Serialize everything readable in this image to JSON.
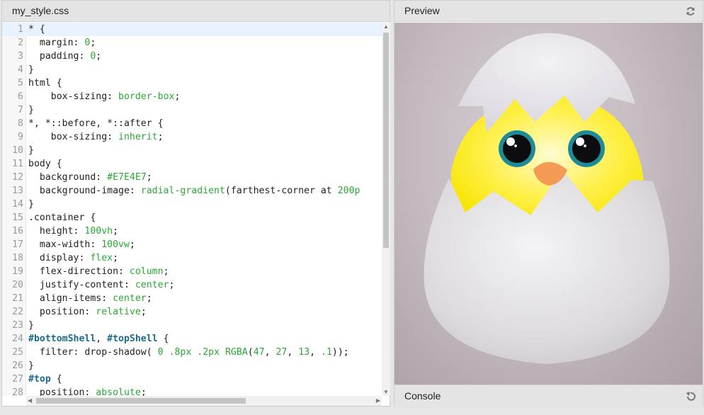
{
  "editor": {
    "filename": "my_style.css",
    "lines": [
      {
        "n": "1",
        "parts": [
          [
            "sel",
            "* {"
          ]
        ]
      },
      {
        "n": "2",
        "parts": [
          [
            "prop",
            "  margin: "
          ],
          [
            "num",
            "0"
          ],
          [
            "prop",
            ";"
          ]
        ]
      },
      {
        "n": "3",
        "parts": [
          [
            "prop",
            "  padding: "
          ],
          [
            "num",
            "0"
          ],
          [
            "prop",
            ";"
          ]
        ]
      },
      {
        "n": "4",
        "parts": [
          [
            "sel",
            "}"
          ]
        ]
      },
      {
        "n": "5",
        "parts": [
          [
            "sel",
            "html {"
          ]
        ]
      },
      {
        "n": "6",
        "parts": [
          [
            "prop",
            "    box-sizing: "
          ],
          [
            "val",
            "border-box"
          ],
          [
            "prop",
            ";"
          ]
        ]
      },
      {
        "n": "7",
        "parts": [
          [
            "sel",
            "}"
          ]
        ]
      },
      {
        "n": "8",
        "parts": [
          [
            "sel",
            "*, *::before, *::after {"
          ]
        ]
      },
      {
        "n": "9",
        "parts": [
          [
            "prop",
            "    box-sizing: "
          ],
          [
            "val",
            "inherit"
          ],
          [
            "prop",
            ";"
          ]
        ]
      },
      {
        "n": "10",
        "parts": [
          [
            "sel",
            "}"
          ]
        ]
      },
      {
        "n": "11",
        "parts": [
          [
            "sel",
            "body {"
          ]
        ]
      },
      {
        "n": "12",
        "parts": [
          [
            "prop",
            "  background: "
          ],
          [
            "val",
            "#E7E4E7"
          ],
          [
            "prop",
            ";"
          ]
        ]
      },
      {
        "n": "13",
        "parts": [
          [
            "prop",
            "  background-image: "
          ],
          [
            "val",
            "radial-gradient"
          ],
          [
            "prop",
            "(farthest-corner at "
          ],
          [
            "num",
            "200p"
          ]
        ]
      },
      {
        "n": "14",
        "parts": [
          [
            "sel",
            "}"
          ]
        ]
      },
      {
        "n": "15",
        "parts": [
          [
            "sel",
            ".container {"
          ]
        ]
      },
      {
        "n": "16",
        "parts": [
          [
            "prop",
            "  height: "
          ],
          [
            "val",
            "100vh"
          ],
          [
            "prop",
            ";"
          ]
        ]
      },
      {
        "n": "17",
        "parts": [
          [
            "prop",
            "  max-width: "
          ],
          [
            "val",
            "100vw"
          ],
          [
            "prop",
            ";"
          ]
        ]
      },
      {
        "n": "18",
        "parts": [
          [
            "prop",
            "  display: "
          ],
          [
            "val",
            "flex"
          ],
          [
            "prop",
            ";"
          ]
        ]
      },
      {
        "n": "19",
        "parts": [
          [
            "prop",
            "  flex-direction: "
          ],
          [
            "val",
            "column"
          ],
          [
            "prop",
            ";"
          ]
        ]
      },
      {
        "n": "20",
        "parts": [
          [
            "prop",
            "  justify-content: "
          ],
          [
            "val",
            "center"
          ],
          [
            "prop",
            ";"
          ]
        ]
      },
      {
        "n": "21",
        "parts": [
          [
            "prop",
            "  align-items: "
          ],
          [
            "val",
            "center"
          ],
          [
            "prop",
            ";"
          ]
        ]
      },
      {
        "n": "22",
        "parts": [
          [
            "prop",
            "  position: "
          ],
          [
            "val",
            "relative"
          ],
          [
            "prop",
            ";"
          ]
        ]
      },
      {
        "n": "23",
        "parts": [
          [
            "sel",
            "}"
          ]
        ]
      },
      {
        "n": "24",
        "parts": [
          [
            "id",
            "#bottomShell"
          ],
          [
            "sel",
            ", "
          ],
          [
            "id",
            "#topShell"
          ],
          [
            "sel",
            " {"
          ]
        ]
      },
      {
        "n": "25",
        "parts": [
          [
            "prop",
            "  filter: drop-shadow( "
          ],
          [
            "num",
            "0"
          ],
          [
            "prop",
            " "
          ],
          [
            "num",
            ".8px"
          ],
          [
            "prop",
            " "
          ],
          [
            "num",
            ".2px"
          ],
          [
            "prop",
            " "
          ],
          [
            "val",
            "RGBA"
          ],
          [
            "prop",
            "("
          ],
          [
            "num",
            "47"
          ],
          [
            "prop",
            ", "
          ],
          [
            "num",
            "27"
          ],
          [
            "prop",
            ", "
          ],
          [
            "num",
            "13"
          ],
          [
            "prop",
            ", "
          ],
          [
            "num",
            ".1"
          ],
          [
            "prop",
            "));"
          ]
        ]
      },
      {
        "n": "26",
        "parts": [
          [
            "sel",
            "}"
          ]
        ]
      },
      {
        "n": "27",
        "parts": [
          [
            "id",
            "#top"
          ],
          [
            "sel",
            " {"
          ]
        ]
      },
      {
        "n": "28",
        "parts": [
          [
            "prop",
            "  position: "
          ],
          [
            "val",
            "absolute"
          ],
          [
            "prop",
            ";"
          ]
        ]
      }
    ]
  },
  "preview": {
    "title": "Preview",
    "refresh_icon": "refresh-icon"
  },
  "console": {
    "title": "Console",
    "reset_icon": "undo-icon"
  },
  "colors": {
    "token_value": "#2aa835",
    "token_id": "#1a6a8a",
    "chick_yellow": "#ffef2a",
    "beak": "#f39a55",
    "eye_ring": "#1a8a96"
  }
}
